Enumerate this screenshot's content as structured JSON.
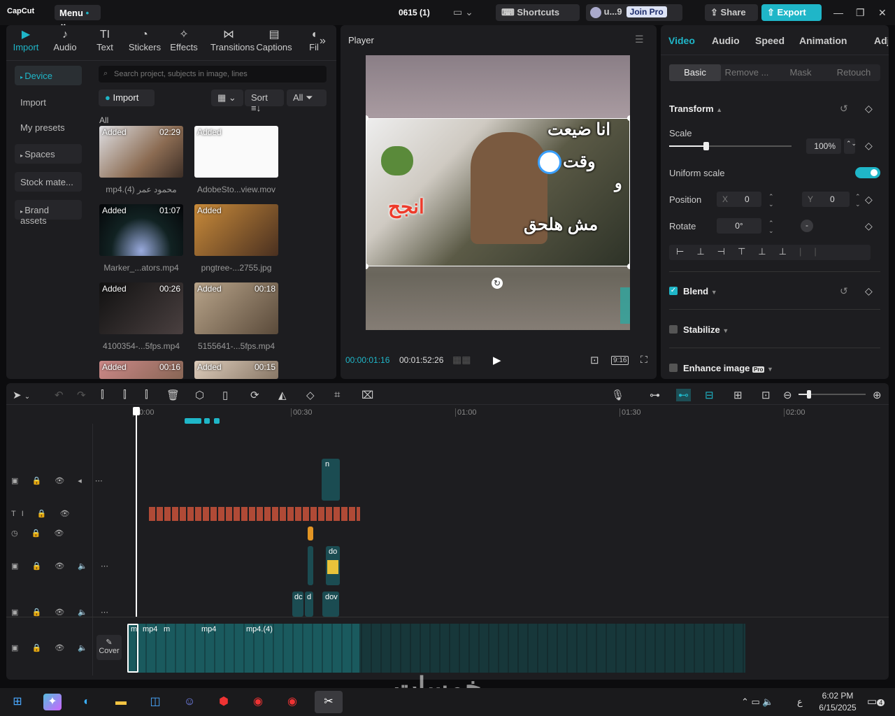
{
  "app": {
    "logo": "CapCut",
    "menu": "Menu",
    "project": "0615 (1)",
    "shortcuts": "Shortcuts",
    "user": "u...9",
    "join_pro": "Join Pro",
    "share": "Share",
    "export": "Export"
  },
  "media": {
    "tabs": [
      {
        "label": "Import",
        "icon": "import-icon",
        "active": true
      },
      {
        "label": "Audio",
        "icon": "audio-icon"
      },
      {
        "label": "Text",
        "icon": "text-icon",
        "glyph": "TI"
      },
      {
        "label": "Stickers",
        "icon": "sticker-icon"
      },
      {
        "label": "Effects",
        "icon": "effects-icon"
      },
      {
        "label": "Transitions",
        "icon": "transitions-icon"
      },
      {
        "label": "Captions",
        "icon": "captions-icon"
      },
      {
        "label": "Fil",
        "icon": "filters-icon"
      }
    ],
    "sidebar": [
      "Device",
      "Import",
      "My presets",
      "Spaces",
      "Stock mate...",
      "Brand assets"
    ],
    "search_placeholder": "Search project, subjects in image, lines",
    "import_label": "Import",
    "sort_label": "Sort",
    "all_label": "All",
    "section_label": "All",
    "items": [
      {
        "tag": "Added",
        "duration": "02:29",
        "name": "mp4.(4) محمود عمر"
      },
      {
        "tag": "Added",
        "duration": "",
        "name": "AdobeSto...view.mov"
      },
      {
        "tag": "Added",
        "duration": "01:07",
        "name": "Marker_...ators.mp4"
      },
      {
        "tag": "Added",
        "duration": "",
        "name": "pngtree-...2755.jpg"
      },
      {
        "tag": "Added",
        "duration": "00:26",
        "name": "4100354-...5fps.mp4"
      },
      {
        "tag": "Added",
        "duration": "00:18",
        "name": "5155641-...5fps.mp4"
      },
      {
        "tag": "Added",
        "duration": "00:16",
        "name": ""
      },
      {
        "tag": "Added",
        "duration": "00:15",
        "name": ""
      }
    ]
  },
  "player": {
    "title": "Player",
    "current": "00:00:01:16",
    "total": "00:01:52:26",
    "ratio": "9:16",
    "overlay": [
      "انا ضيعت",
      "وقت",
      "و",
      "انجح",
      "مش هلحق"
    ]
  },
  "inspector": {
    "tabs": [
      "Video",
      "Audio",
      "Speed",
      "Animation",
      "Adju"
    ],
    "subtabs": [
      "Basic",
      "Remove ...",
      "Mask",
      "Retouch"
    ],
    "transform": "Transform",
    "scale_label": "Scale",
    "scale_value": "100%",
    "scale_fraction": 0.3,
    "uniform": "Uniform scale",
    "position_label": "Position",
    "x_label": "X",
    "x_value": "0",
    "y_label": "Y",
    "y_value": "0",
    "rotate_label": "Rotate",
    "rotate_value": "0°",
    "blend": "Blend",
    "stabilize": "Stabilize",
    "enhance": "Enhance image",
    "pro": "Pro"
  },
  "timeline": {
    "ticks": [
      "00:00",
      "00:30",
      "01:00",
      "01:30",
      "02:00"
    ],
    "cover": "Cover",
    "clip_labels": [
      "m",
      "mp4",
      "m",
      "mp4",
      "mp4.(4)",
      "do",
      "dov",
      "dc",
      "d",
      "n"
    ]
  },
  "taskbar": {
    "time": "6:02 PM",
    "date": "6/15/2025",
    "lang": "ع",
    "notif": "4"
  },
  "watermark": "خمسات"
}
